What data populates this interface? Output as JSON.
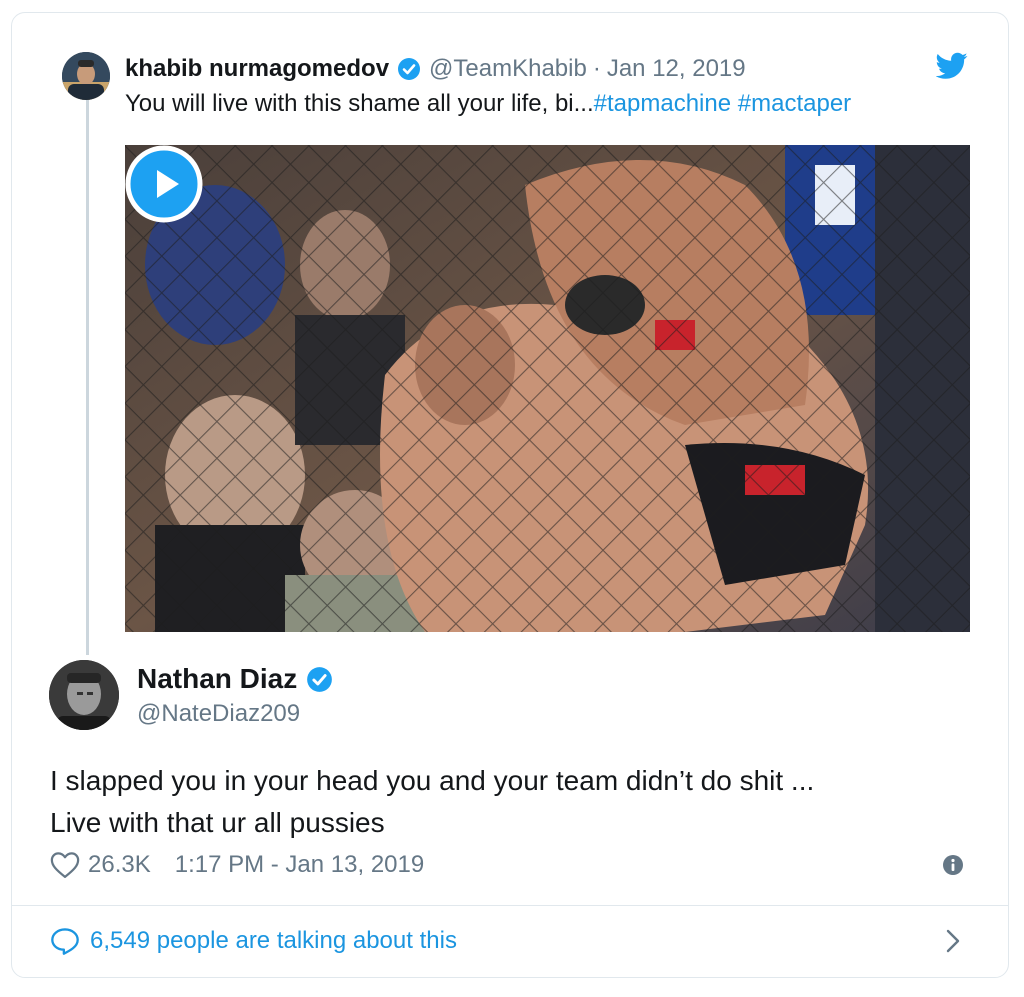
{
  "parent_tweet": {
    "author_name": "khabib nurmagomedov",
    "handle": "@TeamKhabib",
    "separator": "·",
    "date": "Jan 12, 2019",
    "text": "You will live with this shame all your life, bi...",
    "hashtags": [
      "#tapmachine",
      "#mactaper"
    ],
    "media_type": "video",
    "icons": {
      "verified": "verified-badge-icon",
      "brand": "twitter-bird-icon",
      "play": "play-icon"
    }
  },
  "main_tweet": {
    "author_name": "Nathan Diaz",
    "handle": "@NateDiaz209",
    "text_lines": [
      "I slapped you in your head you and your team didn’t do shit ...",
      "Live with that ur all pussies"
    ],
    "likes": "26.3K",
    "timestamp": "1:17 PM - Jan 13, 2019",
    "icons": {
      "like": "heart-icon",
      "info": "info-icon"
    }
  },
  "footer": {
    "talking_text": "6,549 people are talking about this",
    "icons": {
      "reply": "speech-bubble-icon",
      "more": "chevron-right-icon"
    }
  },
  "colors": {
    "link_blue": "#1b95e0",
    "verified_blue": "#1da1f2",
    "secondary_text": "#657786",
    "border": "#e1e8ed"
  }
}
